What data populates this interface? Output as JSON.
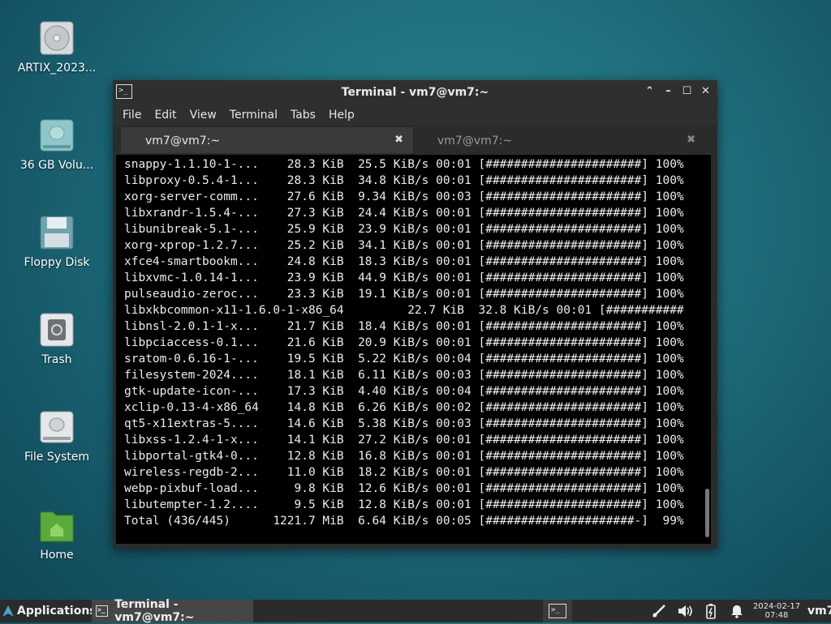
{
  "desktop": {
    "icons": [
      {
        "label": "ARTIX_2023...",
        "icon": "optical-disc-icon"
      },
      {
        "label": "36 GB Volu...",
        "icon": "hard-drive-icon"
      },
      {
        "label": "Floppy Disk",
        "icon": "floppy-disk-icon"
      },
      {
        "label": "Trash",
        "icon": "trash-icon"
      },
      {
        "label": "File System",
        "icon": "file-system-icon"
      },
      {
        "label": "Home",
        "icon": "home-folder-icon"
      }
    ]
  },
  "window": {
    "title": "Terminal - vm7@vm7:~",
    "menu": [
      "File",
      "Edit",
      "View",
      "Terminal",
      "Tabs",
      "Help"
    ],
    "tabs": [
      {
        "label": "vm7@vm7:~",
        "close": "✖",
        "active": true
      },
      {
        "label": "vm7@vm7:~",
        "close": "✖",
        "active": false
      }
    ],
    "terminal_lines": [
      "snappy-1.1.10-1-...    28.3 KiB  25.5 KiB/s 00:01 [######################] 100%",
      "libproxy-0.5.4-1...    28.3 KiB  34.8 KiB/s 00:01 [######################] 100%",
      "xorg-server-comm...    27.6 KiB  9.34 KiB/s 00:03 [######################] 100%",
      "libxrandr-1.5.4-...    27.3 KiB  24.4 KiB/s 00:01 [######################] 100%",
      "libunibreak-5.1-...    25.9 KiB  23.9 KiB/s 00:01 [######################] 100%",
      "xorg-xprop-1.2.7...    25.2 KiB  34.1 KiB/s 00:01 [######################] 100%",
      "xfce4-smartbookm...    24.8 KiB  18.3 KiB/s 00:01 [######################] 100%",
      "libxvmc-1.0.14-1...    23.9 KiB  44.9 KiB/s 00:01 [######################] 100%",
      "pulseaudio-zeroc...    23.3 KiB  19.1 KiB/s 00:01 [######################] 100%",
      "libxkbcommon-x11-1.6.0-1-x86_64         22.7 KiB  32.8 KiB/s 00:01 [###########",
      "libnsl-2.0.1-1-x...    21.7 KiB  18.4 KiB/s 00:01 [######################] 100%",
      "libpciaccess-0.1...    21.6 KiB  20.9 KiB/s 00:01 [######################] 100%",
      "sratom-0.6.16-1-...    19.5 KiB  5.22 KiB/s 00:04 [######################] 100%",
      "filesystem-2024....    18.1 KiB  6.11 KiB/s 00:03 [######################] 100%",
      "gtk-update-icon-...    17.3 KiB  4.40 KiB/s 00:04 [######################] 100%",
      "xclip-0.13-4-x86_64    14.8 KiB  6.26 KiB/s 00:02 [######################] 100%",
      "qt5-x11extras-5....    14.6 KiB  5.38 KiB/s 00:03 [######################] 100%",
      "libxss-1.2.4-1-x...    14.1 KiB  27.2 KiB/s 00:01 [######################] 100%",
      "libportal-gtk4-0...    12.8 KiB  16.8 KiB/s 00:01 [######################] 100%",
      "wireless-regdb-2...    11.0 KiB  18.2 KiB/s 00:01 [######################] 100%",
      "webp-pixbuf-load...     9.8 KiB  12.6 KiB/s 00:01 [######################] 100%",
      "libutempter-1.2....     9.5 KiB  12.8 KiB/s 00:01 [######################] 100%",
      "Total (436/445)      1221.7 MiB  6.64 KiB/s 00:05 [#####################-]  99%"
    ]
  },
  "taskbar": {
    "applications_label": "Applications",
    "task_label": "Terminal - vm7@vm7:~",
    "clock_date": "2024-02-17",
    "clock_time": "07:48",
    "user": "vm7",
    "tray_icons": [
      "network-icon",
      "volume-icon",
      "battery-icon",
      "notification-bell-icon"
    ]
  }
}
